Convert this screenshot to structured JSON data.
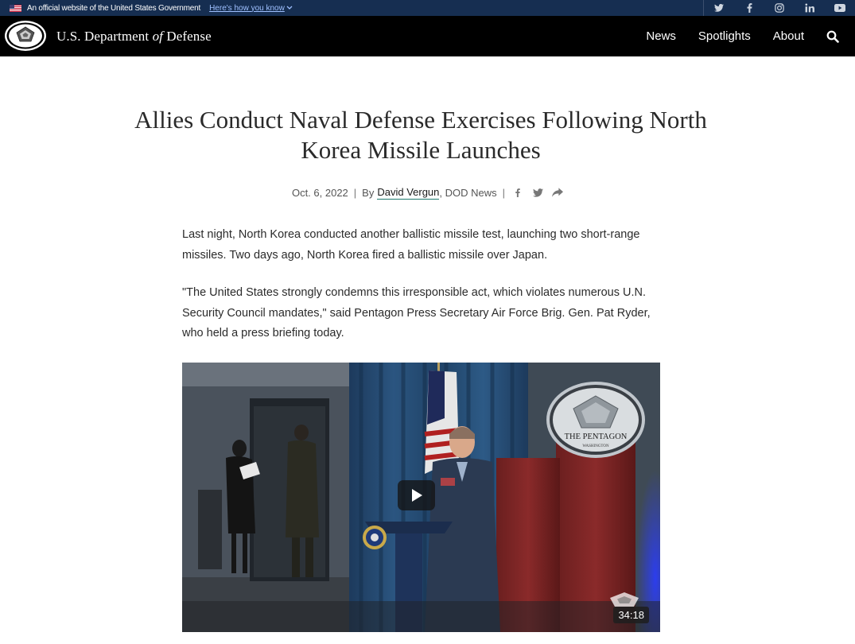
{
  "gov_banner": {
    "official_text": "An official website of the United States Government",
    "how_link": "Here's how you know",
    "social_icons": [
      "twitter-icon",
      "facebook-icon",
      "instagram-icon",
      "linkedin-icon",
      "youtube-icon"
    ]
  },
  "header": {
    "brand_prefix": "U.S. Department ",
    "brand_of": "of",
    "brand_suffix": " Defense",
    "nav": [
      "News",
      "Spotlights",
      "About"
    ]
  },
  "article": {
    "title": "Allies Conduct Naval Defense Exercises Following North Korea Missile Launches",
    "date": "Oct. 6, 2022",
    "by": "By",
    "author": "David Vergun",
    "source": ", DOD News",
    "paragraphs": [
      "Last night, North Korea conducted another ballistic missile test, launching two short-range missiles. Two days ago, North Korea fired a ballistic missile over Japan.",
      "\"The United States strongly condemns this irresponsible act, which violates numerous U.N. Security Council mandates,\" said Pentagon Press Secretary Air Force Brig. Gen. Pat Ryder, who held a press briefing today."
    ]
  },
  "video": {
    "duration": "34:18",
    "seal_text": "THE PENTAGON",
    "seal_subtext": "WASHINGTON"
  },
  "colors": {
    "gov_banner_bg": "#162e51",
    "header_bg": "#000000",
    "author_underline": "#1f7a6f"
  }
}
